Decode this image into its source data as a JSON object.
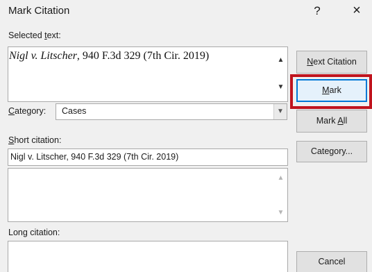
{
  "window": {
    "title": "Mark Citation",
    "help_symbol": "?",
    "close_symbol": "×"
  },
  "selected_text": {
    "label_prefix": "Selected ",
    "label_accel": "t",
    "label_suffix": "ext:",
    "case_name": "Nigl v. Litscher",
    "citation_rest": ", 940 F.3d 329 (7th Cir. 2019)"
  },
  "category": {
    "label_accel": "C",
    "label_suffix": "ategory:",
    "selected_value": "Cases"
  },
  "short_citation": {
    "label_accel": "S",
    "label_suffix": "hort citation:",
    "value": "Nigl v. Litscher, 940 F.3d 329 (7th Cir. 2019)"
  },
  "long_citation": {
    "label": "Long citation:"
  },
  "buttons": {
    "next_accel": "N",
    "next_suffix": "ext Citation",
    "mark_accel": "M",
    "mark_suffix": "ark",
    "markall_prefix": "Mark ",
    "markall_accel": "A",
    "markall_suffix": "ll",
    "category_prefix": "Cate",
    "category_accel": "g",
    "category_suffix": "ory...",
    "cancel": "Cancel"
  },
  "icons": {
    "scroll_up": "up-arrow-icon",
    "scroll_down": "down-arrow-icon",
    "dropdown": "chevron-down-icon"
  },
  "colors": {
    "highlight": "#c0141e",
    "focus_border": "#0078d7"
  }
}
